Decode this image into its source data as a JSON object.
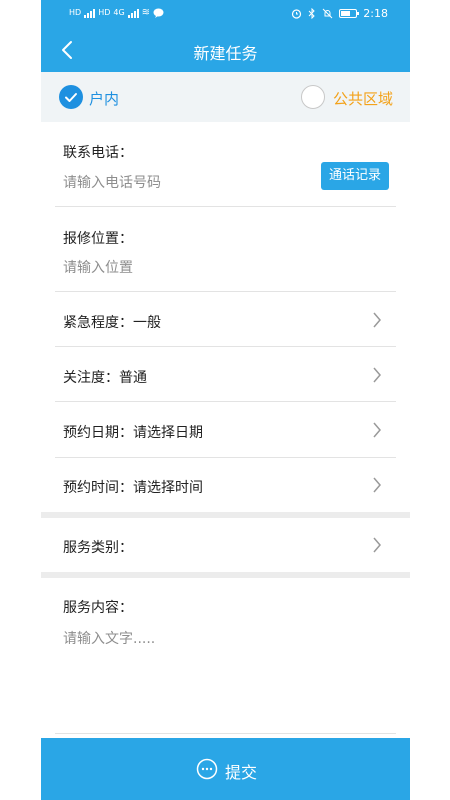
{
  "status_bar": {
    "left_badges": [
      "HD",
      "HD"
    ],
    "network_label": "4G",
    "time": "2:18"
  },
  "header": {
    "title": "新建任务"
  },
  "location": {
    "options": [
      {
        "label": "户内",
        "selected": true
      },
      {
        "label": "公共区域",
        "selected": false
      }
    ]
  },
  "form": {
    "phone": {
      "label": "联系电话：",
      "placeholder": "请输入电话号码",
      "call_log_button": "通话记录"
    },
    "location": {
      "label": "报修位置：",
      "placeholder": "请输入位置"
    },
    "urgency": {
      "label": "紧急程度：一般"
    },
    "attention": {
      "label": "关注度：普通"
    },
    "appointment_date": {
      "label": "预约日期：请选择日期"
    },
    "appointment_time": {
      "label": "预约时间：请选择时间"
    },
    "service_category": {
      "label": "服务类别："
    },
    "service_content": {
      "label": "服务内容：",
      "placeholder": "请输入文字....."
    }
  },
  "submit": {
    "label": "提交"
  },
  "colors": {
    "primary": "#2aa6e6",
    "checked": "#1e90e0",
    "accent_orange": "#f3a21a"
  },
  "icons": {
    "back": "chevron-left-icon",
    "row_arrow": "chevron-right-icon",
    "check": "check-icon",
    "submit": "chat-bubble-dots-icon"
  }
}
